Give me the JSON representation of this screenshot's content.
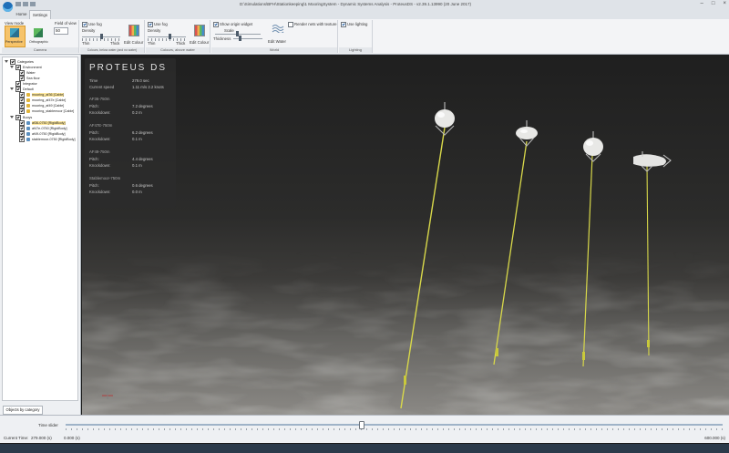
{
  "window": {
    "title": "D:\\Simulations\\BFH\\Stationkeeping\\1 MooringSystem - Dynamic Systems Analysis - ProteusDS - v2.39.1.13990 (20 June 2017)",
    "controls": [
      "–",
      "□",
      "×"
    ]
  },
  "tabs": [
    {
      "label": "Home"
    },
    {
      "label": "Settings"
    }
  ],
  "ribbon": {
    "camera": {
      "view_mode_label": "View mode",
      "field_of_view_label": "Field of view",
      "field_of_view_value": "50",
      "perspective_label": "Perspective",
      "orthographic_label": "Orthographic",
      "caption": "Camera"
    },
    "water_fog": {
      "use_fog_label": "Use fog",
      "density_label": "Density",
      "thin_label": "Thin",
      "thick_label": "Thick",
      "edit_colour_label": "Edit Colour",
      "caption": "Colours, below water (and no water)"
    },
    "above_fog": {
      "use_fog_label": "Use fog",
      "density_label": "Density",
      "thin_label": "Thin",
      "thick_label": "Thick",
      "edit_colour_label": "Edit Colour",
      "caption": "Colours, above water"
    },
    "world": {
      "show_origin_label": "Show origin widget",
      "scale_label": "Scale",
      "thickness_label": "Thickness",
      "edit_water_label": "Edit Water",
      "render_nets_label": "Render nets with texture",
      "caption": "World"
    },
    "lighting": {
      "use_lighting_label": "Use lighting",
      "caption": "Lighting"
    }
  },
  "tree": {
    "rows": [
      {
        "label": "Categories"
      },
      {
        "label": "Environment"
      },
      {
        "label": "Water"
      },
      {
        "label": "Sea floor"
      },
      {
        "label": "Integrator"
      },
      {
        "label": "Default"
      },
      {
        "label": "mooring_af36 [Cable]"
      },
      {
        "label": "mooring_af47e [Cable]"
      },
      {
        "label": "mooring_af49 [Cable]"
      },
      {
        "label": "mooring_stablemoor [Cable]"
      },
      {
        "label": "Buoys"
      },
      {
        "label": "af36-0750 [RigidBody]"
      },
      {
        "label": "af47e-0750 [RigidBody]"
      },
      {
        "label": "af49-0750 [RigidBody]"
      },
      {
        "label": "stablemoor-0750 [RigidBody]"
      }
    ],
    "footer_tab": "Objects by category"
  },
  "info": {
    "logo": "PROTEUS DS",
    "time_label": "Time",
    "time_value": "279.0 sec",
    "current_label": "Current speed",
    "current_value": "1.11 m/s 2.2 knots",
    "buoys": [
      {
        "name": "AF36-750m",
        "pitch_label": "Pitch:",
        "pitch": "7.2 degrees",
        "knockdown_label": "Knockdown:",
        "knockdown": "0.2 m"
      },
      {
        "name": "AF47E-750m",
        "pitch_label": "Pitch:",
        "pitch": "6.2 degrees",
        "knockdown_label": "Knockdown:",
        "knockdown": "0.1 m"
      },
      {
        "name": "AF49-750m",
        "pitch_label": "Pitch:",
        "pitch": "4.4 degrees",
        "knockdown_label": "Knockdown:",
        "knockdown": "0.1 m"
      },
      {
        "name": "Stablemoor-750m",
        "pitch_label": "Pitch:",
        "pitch": "0.6 degrees",
        "knockdown_label": "Knockdown:",
        "knockdown": "0.0 m"
      }
    ]
  },
  "timeline": {
    "slider_label": "Time slider",
    "position_fraction": 0.45,
    "current_time_label": "Current Time:",
    "current_time_value": "279.000 (s)",
    "mid_value": "0.000 (s)",
    "end_value": "600.000 (s)"
  },
  "colors": {
    "accent": "#f6c36a",
    "cable": "#d8d84a",
    "buoy": "#e8e8e6",
    "ribbon_bg": "#f3f4f6"
  }
}
